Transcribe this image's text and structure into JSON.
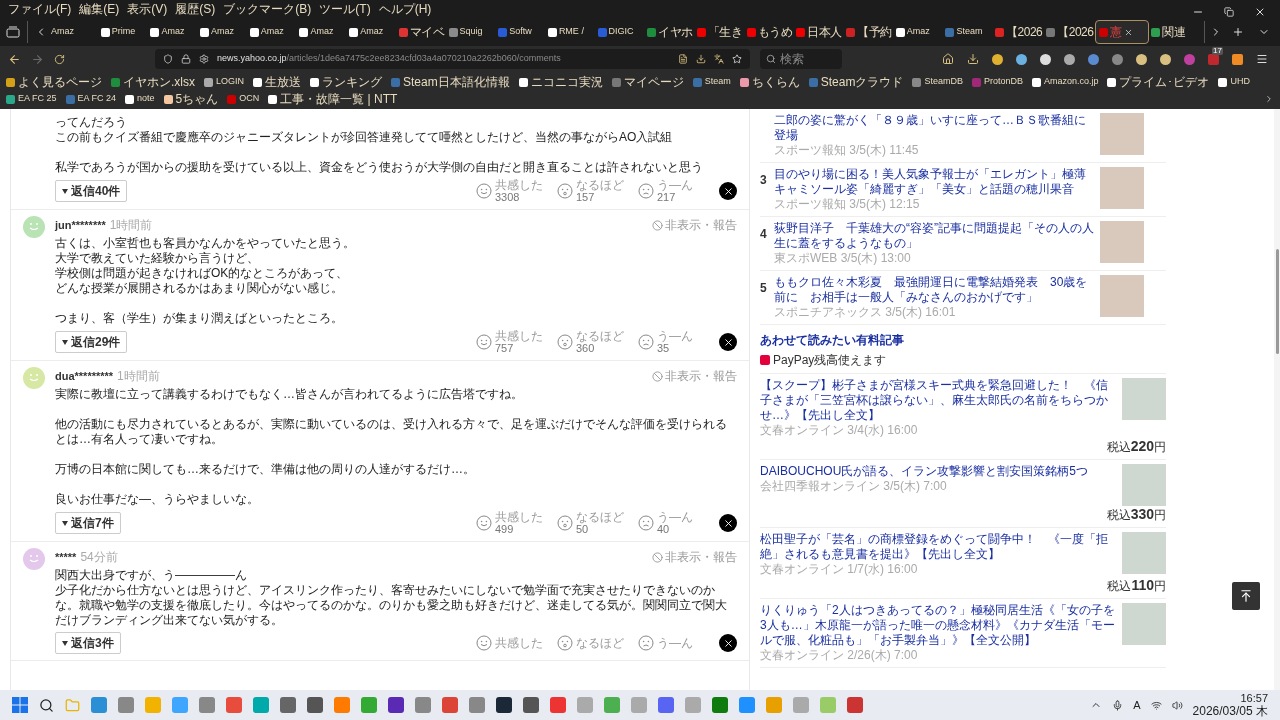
{
  "menu_bar": [
    "ファイル(F)",
    "編集(E)",
    "表示(V)",
    "履歴(S)",
    "ブックマーク(B)",
    "ツール(T)",
    "ヘルプ(H)"
  ],
  "tabs": [
    {
      "label": "Amaz",
      "selected": false
    },
    {
      "label": "Prime",
      "selected": false
    },
    {
      "label": "Amaz",
      "selected": false
    },
    {
      "label": "Amaz",
      "selected": false
    },
    {
      "label": "Amaz",
      "selected": false
    },
    {
      "label": "Amaz",
      "selected": false
    },
    {
      "label": "Amaz",
      "selected": false
    },
    {
      "label": "マイベ",
      "selected": false
    },
    {
      "label": "Squig",
      "selected": false
    },
    {
      "label": "Softw",
      "selected": false
    },
    {
      "label": "RME /",
      "selected": false
    },
    {
      "label": "DIGIC",
      "selected": false
    },
    {
      "label": "イヤホ",
      "selected": false
    },
    {
      "label": "「生き",
      "selected": false
    },
    {
      "label": "もうめ",
      "selected": false
    },
    {
      "label": "日本人",
      "selected": false
    },
    {
      "label": "【予約",
      "selected": false
    },
    {
      "label": "Amaz",
      "selected": false
    },
    {
      "label": "Steam",
      "selected": false
    },
    {
      "label": "【2026",
      "selected": false
    },
    {
      "label": "【2026",
      "selected": false
    },
    {
      "label": "憲",
      "selected": true
    },
    {
      "label": "関連",
      "selected": false
    }
  ],
  "address_bar": {
    "host": "news.yahoo.co.jp",
    "path": "/articles/1de6a7475c2ee8234cfd03a4a070210a2262b060/comments"
  },
  "search": {
    "placeholder": "検索"
  },
  "extension_badge": "17",
  "bookmarks": [
    "よく見るページ",
    "イヤホン.xlsx",
    "LOGIN",
    "生放送",
    "ランキング",
    "Steam日本語化情報",
    "ニコニコ実況",
    "マイページ",
    "Steam",
    "ちくらん",
    "Steamクラウド",
    "SteamDB",
    "ProtonDB",
    "Amazon.co.jp",
    "プライム･ビデオ",
    "UHD",
    "EA FC 25",
    "EA FC 24",
    "note",
    "5ちゃん",
    "OCN",
    "工事・故障一覧 | NTT"
  ],
  "comments": [
    {
      "paragraphs": [
        [
          "ってんだろう",
          "この前もクイズ番組で慶應卒のジャニーズタレントが珍回答連発してて唖然としたけど、当然の事ながらAO入試組"
        ],
        [
          "私学であろうが国からの援助を受けている以上、資金をどう使おうが大学側の自由だと開き直ることは許されないと思う"
        ]
      ],
      "replies": "返信40件",
      "reactions": [
        {
          "label": "共感した",
          "count": "3308"
        },
        {
          "label": "なるほど",
          "count": "157"
        },
        {
          "label": "う―ん",
          "count": "217"
        }
      ]
    },
    {
      "user": "jun********",
      "time": "1時間前",
      "color": "#b9e3b5",
      "hide_report": "非表示・報告",
      "paragraphs": [
        [
          "古くは、小室哲也も客員かなんかをやっていたと思う。",
          "大学で教えていた経験から言うけど、",
          "学校側は問題が起きなければOK的なところがあって、",
          "どんな授業が展開されるかはあまり関心がない感じ。"
        ],
        [
          "つまり、客（学生）が集まり潤えばといったところ。"
        ]
      ],
      "replies": "返信29件",
      "reactions": [
        {
          "label": "共感した",
          "count": "757"
        },
        {
          "label": "なるほど",
          "count": "360"
        },
        {
          "label": "う―ん",
          "count": "35"
        }
      ]
    },
    {
      "user": "dua*********",
      "time": "1時間前",
      "color": "#d6e8a3",
      "hide_report": "非表示・報告",
      "paragraphs": [
        [
          "実際に教壇に立って講義するわけでもなく…皆さんが言われてるように広告塔ですね。"
        ],
        [
          "他の活動にも尽力されているとあるが、実際に動いているのは、受け入れる方々で、足を運ぶだけでそんな評価を受けられるとは…有名人って凄いですね。"
        ],
        [
          "万博の日本館に関しても…来るだけで、準備は他の周りの人達がするだけ…。"
        ],
        [
          "良いお仕事だな―、うらやましいな。"
        ]
      ],
      "replies": "返信7件",
      "reactions": [
        {
          "label": "共感した",
          "count": "499"
        },
        {
          "label": "なるほど",
          "count": "50"
        },
        {
          "label": "う―ん",
          "count": "40"
        }
      ]
    },
    {
      "user": "*****",
      "time": "54分前",
      "color": "#e3c8ec",
      "hide_report": "非表示・報告",
      "paragraphs": [
        [
          "関西大出身ですが、う―――――ん",
          "少子化だから仕方ないとは思うけど、アイスリンク作ったり、客寄せみたいにしないで勉学面で充実させたりできないのかな。就職や勉学の支援を徹底したり。今はやってるのかな。のりかも愛之助も好きだけど、迷走してる気が。関関同立で関大だけブランディング出来てない気がする。"
        ]
      ],
      "replies": "返信3件",
      "reactions": [
        {
          "label": "共感した"
        },
        {
          "label": "なるほど"
        },
        {
          "label": "う―ん"
        }
      ]
    }
  ],
  "ranking": [
    {
      "title": "二郎の姿に驚がく「８９歳」いすに座って…ＢＳ歌番組に登場",
      "source": "スポーツ報知 3/5(木) 11:45"
    },
    {
      "rank": "3",
      "title": "目のやり場に困る！美人気象予報士が「エレガント」極薄キャミソール姿「綺麗すぎ」「美女」と話題の穂川果音",
      "source": "スポーツ報知 3/5(木) 12:15"
    },
    {
      "rank": "4",
      "title": "荻野目洋子　千葉雄大の“容姿”記事に問題提起「その人の人生に蓋をするようなもの」",
      "source": "東スポWEB 3/5(木) 13:00"
    },
    {
      "rank": "5",
      "title": "ももクロ佐々木彩夏　最強開運日に電撃結婚発表　30歳を前に　お相手は一般人「みなさんのおかげです」",
      "source": "スポニチアネックス 3/5(木) 16:01"
    }
  ],
  "paid_section": {
    "title": "あわせて読みたい有料記事",
    "paypay": "PayPay残高使えます"
  },
  "paid_articles": [
    {
      "title": "【スクープ】彬子さまが宮様スキー式典を緊急回避した！　《信子さまが「三笠宮杯は譲らない」、麻生太郎氏の名前をちらつかせ…》【先出し全文】",
      "source": "文春オンライン 3/4(水) 16:00",
      "tax": "税込",
      "price": "220",
      "currency": "円"
    },
    {
      "title": "DAIBOUCHOU氏が語る、イラン攻撃影響と割安国策銘柄5つ",
      "source": "会社四季報オンライン 3/5(木) 7:00",
      "tax": "税込",
      "price": "330",
      "currency": "円"
    },
    {
      "title": "松田聖子が「芸名」の商標登録をめぐって闘争中！　《一度「拒絶」されるも意見書を提出》【先出し全文】",
      "source": "文春オンライン 1/7(水) 16:00",
      "tax": "税込",
      "price": "110",
      "currency": "円"
    },
    {
      "title": "りくりゅう「2人はつきあってるの？」極秘同居生活《「女の子を3人も…」木原龍一が語った唯一の懸念材料》《カナダ生活「モールで服、化粧品も」「お手製弁当」》【全文公開】",
      "source": "文春オンライン 2/26(木) 7:00"
    }
  ],
  "taskbar": {
    "ime": "A",
    "time": "16:57",
    "date": "2026/03/05 木"
  }
}
